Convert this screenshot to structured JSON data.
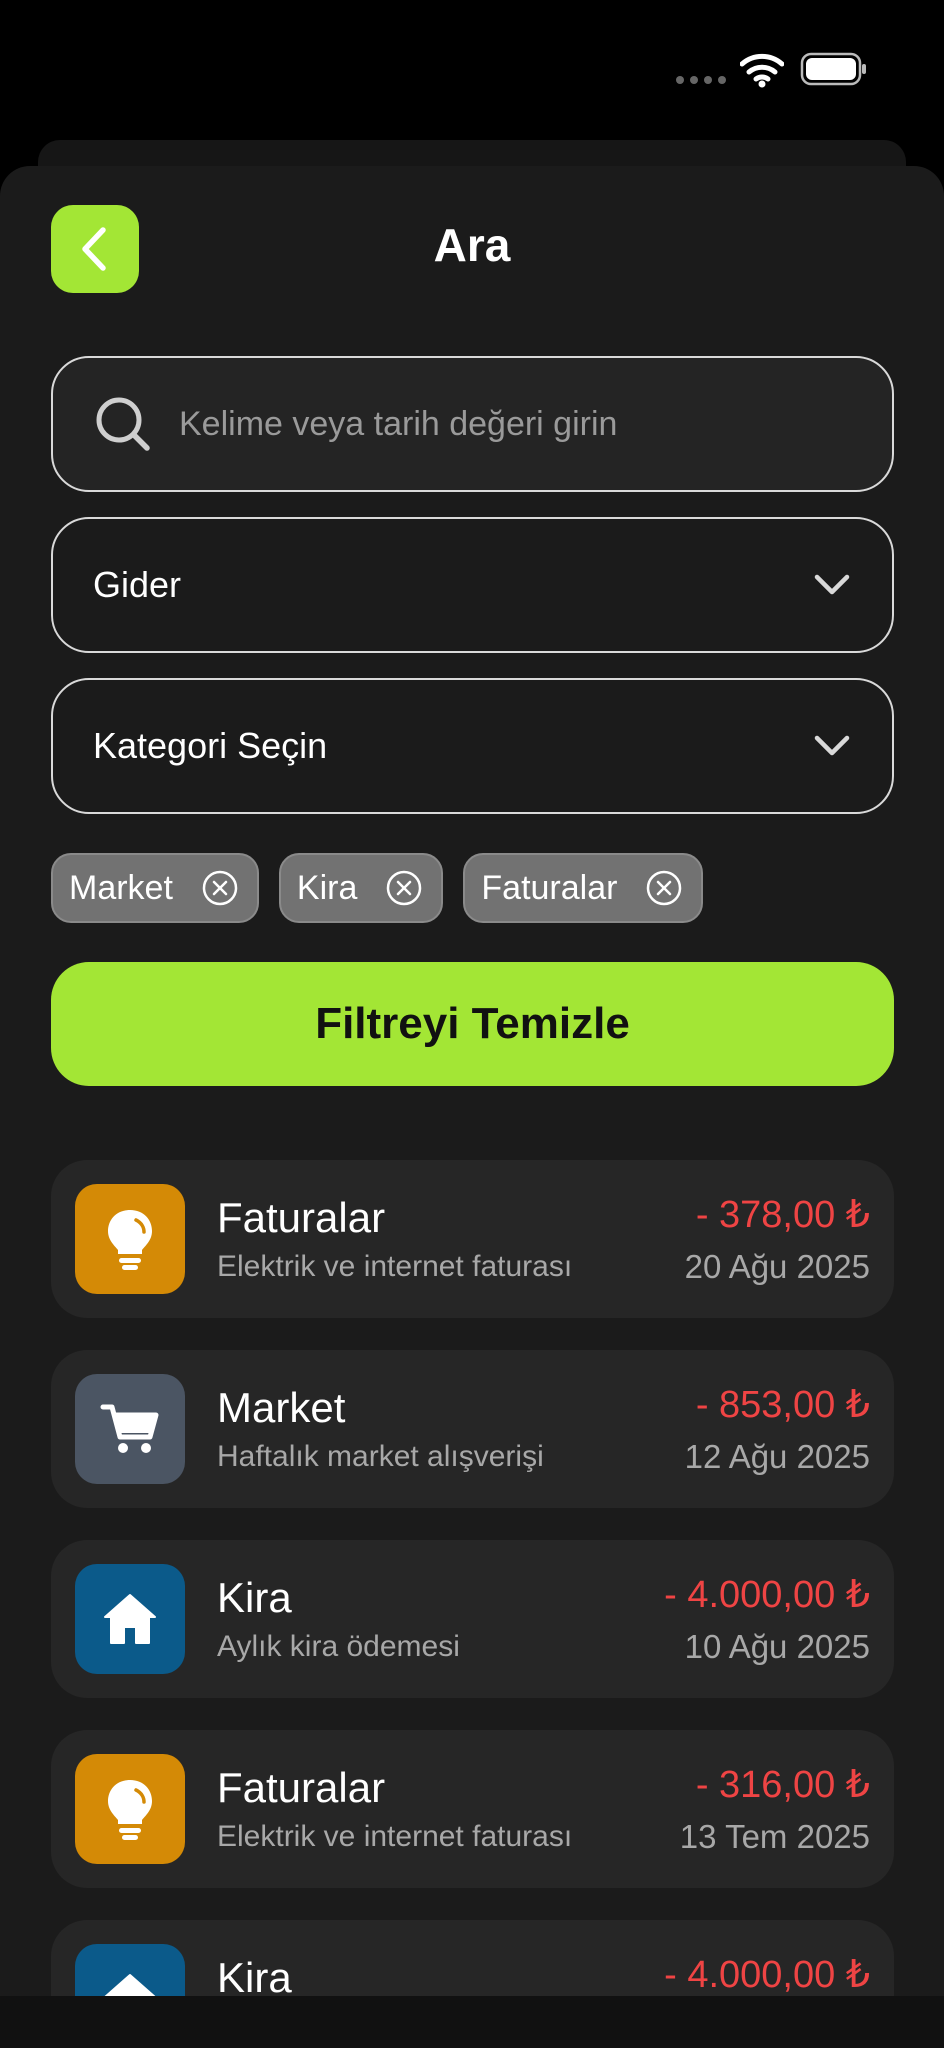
{
  "header": {
    "title": "Ara"
  },
  "search": {
    "placeholder": "Kelime veya tarih değeri girin",
    "value": ""
  },
  "filters": {
    "type_value": "Gider",
    "category_placeholder": "Kategori Seçin"
  },
  "chips": [
    {
      "label": "Market"
    },
    {
      "label": "Kira"
    },
    {
      "label": "Faturalar"
    }
  ],
  "clear_button": {
    "label": "Filtreyi Temizle"
  },
  "transactions": [
    {
      "title": "Faturalar",
      "description": "Elektrik ve internet faturası",
      "amount": "- 378,00 ₺",
      "date": "20 Ağu 2025",
      "icon": "lightbulb-icon",
      "icon_color": "#d48a06"
    },
    {
      "title": "Market",
      "description": "Haftalık market alışverişi",
      "amount": "- 853,00 ₺",
      "date": "12 Ağu 2025",
      "icon": "cart-icon",
      "icon_color": "#4b5563"
    },
    {
      "title": "Kira",
      "description": "Aylık kira ödemesi",
      "amount": "- 4.000,00 ₺",
      "date": "10 Ağu 2025",
      "icon": "home-icon",
      "icon_color": "#0b5a8a"
    },
    {
      "title": "Faturalar",
      "description": "Elektrik ve internet faturası",
      "amount": "- 316,00 ₺",
      "date": "13 Tem 2025",
      "icon": "lightbulb-icon",
      "icon_color": "#d48a06"
    },
    {
      "title": "Kira",
      "description": "",
      "amount": "- 4.000,00 ₺",
      "date": "",
      "icon": "home-icon",
      "icon_color": "#0b5a8a"
    }
  ],
  "colors": {
    "accent": "#a3e635",
    "expense": "#ef4444",
    "background": "#1b1b1b"
  }
}
